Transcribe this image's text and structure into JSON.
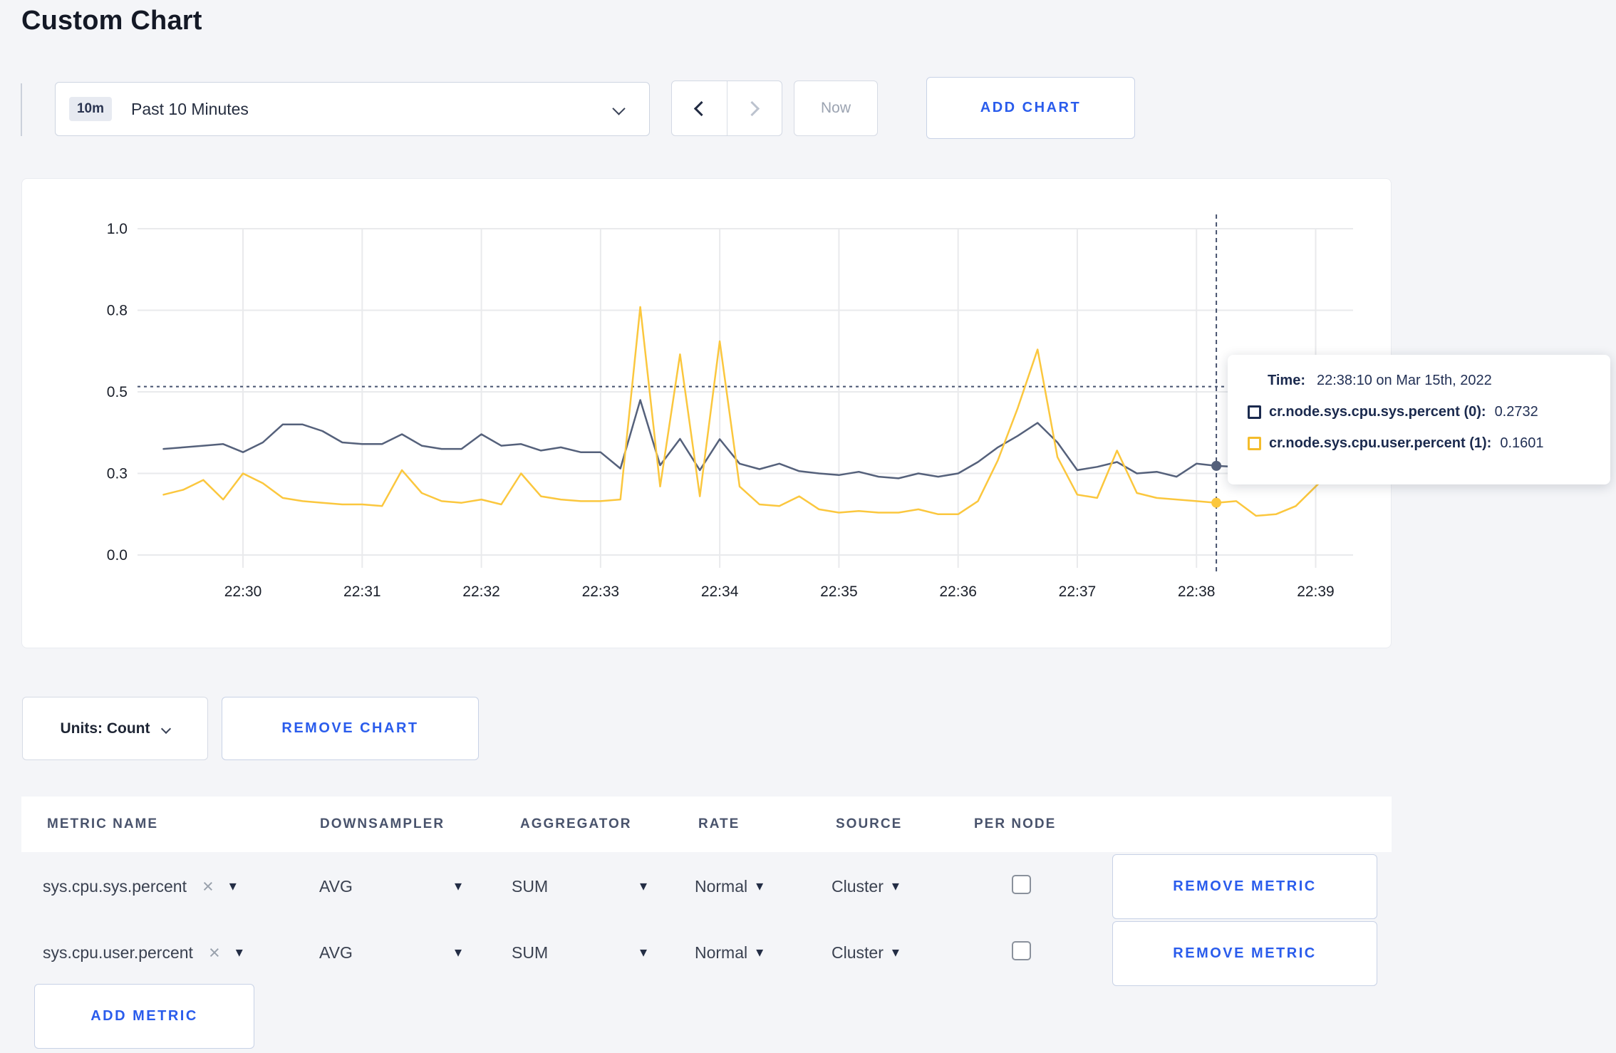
{
  "page": {
    "title": "Custom Chart",
    "background": "#f4f5f8",
    "accent_blue": "#2a5cec"
  },
  "toolbar": {
    "time_range": {
      "badge": "10m",
      "label": "Past 10 Minutes"
    },
    "now_label": "Now",
    "add_chart_label": "ADD CHART"
  },
  "tooltip": {
    "time_label": "Time:",
    "time_value": "22:38:10 on Mar 15th, 2022",
    "entries": [
      {
        "name": "cr.node.sys.cpu.sys.percent (0):",
        "value": "0.2732",
        "color": "#1b2a4e"
      },
      {
        "name": "cr.node.sys.cpu.user.percent (1):",
        "value": "0.1601",
        "color": "#f4bc2b"
      }
    ]
  },
  "units_row": {
    "units_label": "Units: Count",
    "remove_chart_label": "REMOVE CHART"
  },
  "table": {
    "headers": [
      "METRIC NAME",
      "DOWNSAMPLER",
      "AGGREGATOR",
      "RATE",
      "SOURCE",
      "PER NODE"
    ],
    "rows": [
      {
        "metric": "sys.cpu.sys.percent",
        "downsampler": "AVG",
        "aggregator": "SUM",
        "rate": "Normal",
        "source": "Cluster",
        "per_node_checked": false,
        "remove_label": "REMOVE METRIC"
      },
      {
        "metric": "sys.cpu.user.percent",
        "downsampler": "AVG",
        "aggregator": "SUM",
        "rate": "Normal",
        "source": "Cluster",
        "per_node_checked": false,
        "remove_label": "REMOVE METRIC"
      }
    ],
    "add_metric_label": "ADD METRIC"
  },
  "icons": {
    "caret_down": "▾",
    "clear": "×"
  },
  "chart_data": {
    "type": "line",
    "title": "",
    "xlabel": "",
    "ylabel": "",
    "ylim": [
      0,
      1
    ],
    "grid": true,
    "y_ticks": [
      {
        "label": "1.0",
        "v": 1.0
      },
      {
        "label": "0.8",
        "v": 0.75
      },
      {
        "label": "0.5",
        "v": 0.5
      },
      {
        "label": "0.3",
        "v": 0.25
      },
      {
        "label": "0.0",
        "v": 0.0
      }
    ],
    "x_ticks": [
      {
        "label": "22:30",
        "t": 0
      },
      {
        "label": "22:31",
        "t": 1
      },
      {
        "label": "22:32",
        "t": 2
      },
      {
        "label": "22:33",
        "t": 3
      },
      {
        "label": "22:34",
        "t": 4
      },
      {
        "label": "22:35",
        "t": 5
      },
      {
        "label": "22:36",
        "t": 6
      },
      {
        "label": "22:37",
        "t": 7
      },
      {
        "label": "22:38",
        "t": 8
      },
      {
        "label": "22:39",
        "t": 9
      }
    ],
    "x_range_minutes": [
      -0.885,
      9.314
    ],
    "series": [
      {
        "name": "cr.node.sys.cpu.sys.percent",
        "color": "#55617b",
        "start": "22:29:20",
        "interval_s": 10,
        "start_offset_min": -0.66667,
        "values": [
          0.325,
          0.33,
          0.335,
          0.34,
          0.315,
          0.345,
          0.4,
          0.4,
          0.38,
          0.345,
          0.34,
          0.34,
          0.37,
          0.335,
          0.325,
          0.325,
          0.37,
          0.335,
          0.34,
          0.32,
          0.33,
          0.315,
          0.315,
          0.265,
          0.475,
          0.275,
          0.356,
          0.26,
          0.355,
          0.28,
          0.263,
          0.28,
          0.257,
          0.25,
          0.245,
          0.255,
          0.24,
          0.235,
          0.25,
          0.24,
          0.25,
          0.285,
          0.33,
          0.365,
          0.405,
          0.345,
          0.26,
          0.27,
          0.285,
          0.25,
          0.255,
          0.24,
          0.28,
          0.2732,
          0.27,
          0.245,
          0.25,
          0.245,
          0.25,
          0.235,
          0.23
        ]
      },
      {
        "name": "cr.node.sys.cpu.user.percent",
        "color": "#fbc73e",
        "start": "22:29:20",
        "interval_s": 10,
        "start_offset_min": -0.66667,
        "values": [
          0.185,
          0.2,
          0.23,
          0.17,
          0.25,
          0.22,
          0.175,
          0.165,
          0.16,
          0.155,
          0.155,
          0.15,
          0.26,
          0.19,
          0.165,
          0.16,
          0.17,
          0.155,
          0.25,
          0.18,
          0.17,
          0.165,
          0.165,
          0.17,
          0.76,
          0.21,
          0.615,
          0.18,
          0.655,
          0.21,
          0.155,
          0.15,
          0.18,
          0.14,
          0.13,
          0.135,
          0.13,
          0.13,
          0.14,
          0.125,
          0.125,
          0.165,
          0.29,
          0.45,
          0.63,
          0.3,
          0.185,
          0.175,
          0.32,
          0.19,
          0.175,
          0.17,
          0.165,
          0.1601,
          0.165,
          0.12,
          0.125,
          0.15,
          0.21,
          0.27,
          0.245
        ]
      }
    ],
    "crosshair": {
      "time_label": "22:38:10",
      "t": 8.1667,
      "h_value": 0.516,
      "points": [
        {
          "series_index": 0,
          "value": 0.2732
        },
        {
          "series_index": 1,
          "value": 0.1601
        }
      ]
    },
    "legend_position": "tooltip"
  }
}
